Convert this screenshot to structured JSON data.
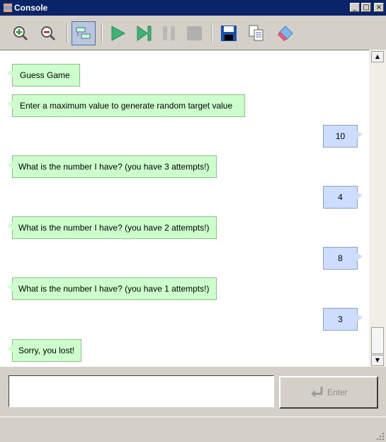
{
  "window": {
    "title": "Console"
  },
  "window_controls": {
    "minimize": "_",
    "maximize": "□",
    "close": "×"
  },
  "toolbar": {
    "icons": [
      "zoom-in-icon",
      "zoom-out-icon",
      "chat-mode-icon",
      "run-icon",
      "step-icon",
      "pause-icon",
      "stop-icon",
      "save-icon",
      "copy-icon",
      "eraser-icon"
    ]
  },
  "messages": [
    {
      "side": "in",
      "text": "Guess Game"
    },
    {
      "side": "in",
      "text": "Enter a maximum value to generate random target value"
    },
    {
      "side": "out",
      "text": "10"
    },
    {
      "side": "in",
      "text": "What is the number I have? (you have 3 attempts!)"
    },
    {
      "side": "out",
      "text": "4"
    },
    {
      "side": "in",
      "text": "What is the number I have? (you have 2 attempts!)"
    },
    {
      "side": "out",
      "text": "8"
    },
    {
      "side": "in",
      "text": "What is the number I have? (you have 1 attempts!)"
    },
    {
      "side": "out",
      "text": "3"
    },
    {
      "side": "in",
      "text": "Sorry, you lost!"
    }
  ],
  "input": {
    "value": "",
    "placeholder": ""
  },
  "enter_button": {
    "label": "Enter"
  },
  "colors": {
    "incoming": "#ccffcc",
    "outgoing": "#ccddff",
    "titlebar": "#0a246a"
  }
}
